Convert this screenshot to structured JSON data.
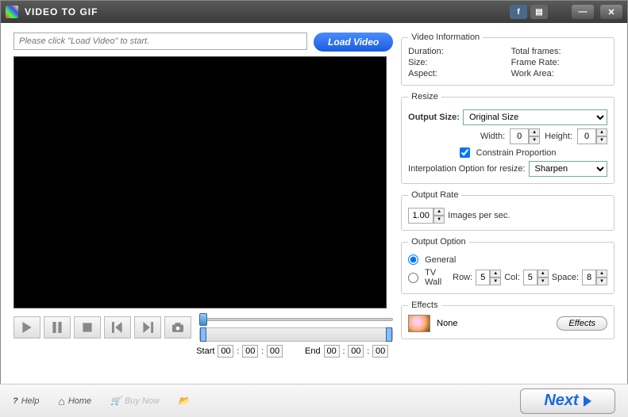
{
  "titlebar": {
    "title": "VIDEO TO GIF"
  },
  "load": {
    "placeholder": "Please click \"Load Video\" to start.",
    "button": "Load Video"
  },
  "video_info": {
    "legend": "Video Information",
    "duration_lbl": "Duration:",
    "size_lbl": "Size:",
    "aspect_lbl": "Aspect:",
    "total_frames_lbl": "Total frames:",
    "frame_rate_lbl": "Frame Rate:",
    "work_area_lbl": "Work Area:"
  },
  "resize": {
    "legend": "Resize",
    "output_size_lbl": "Output Size:",
    "output_size_val": "Original Size",
    "width_lbl": "Width:",
    "width_val": "0",
    "height_lbl": "Height:",
    "height_val": "0",
    "constrain_lbl": "Constrain Proportion",
    "constrain_checked": true,
    "interp_lbl": "Interpolation Option for resize:",
    "interp_val": "Sharpen"
  },
  "output_rate": {
    "legend": "Output Rate",
    "value": "1.00",
    "unit": "Images per sec."
  },
  "output_option": {
    "legend": "Output Option",
    "general": "General",
    "tvwall": "TV Wall",
    "row_lbl": "Row:",
    "row_val": "5",
    "col_lbl": "Col:",
    "col_val": "5",
    "space_lbl": "Space:",
    "space_val": "8"
  },
  "effects": {
    "legend": "Effects",
    "current": "None",
    "button": "Effects"
  },
  "time": {
    "start_lbl": "Start",
    "start_h": "00",
    "start_m": "00",
    "start_s": "00",
    "end_lbl": "End",
    "end_h": "00",
    "end_m": "00",
    "end_s": "00"
  },
  "bottom": {
    "help": "Help",
    "home": "Home",
    "buy": "Buy Now",
    "next": "Next"
  }
}
